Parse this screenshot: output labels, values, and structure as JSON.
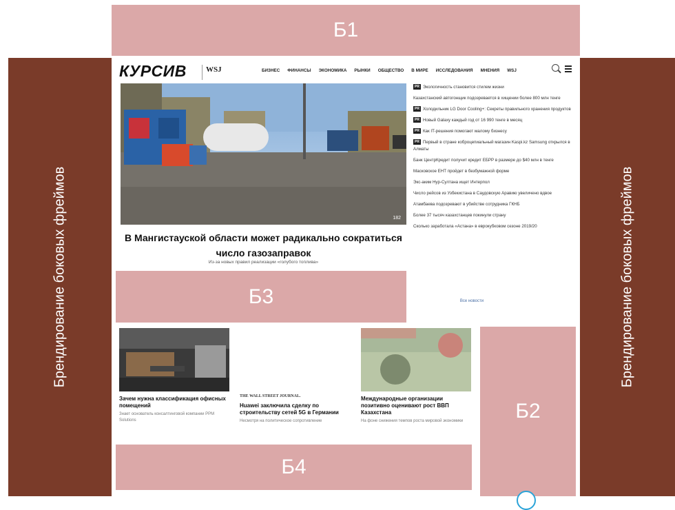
{
  "banners": {
    "b1": "Б1",
    "b2": "Б2",
    "b3": "Б3",
    "b4": "Б4",
    "side_left": "Брендирование боковых фреймов",
    "side_right": "Брендирование боковых фреймов"
  },
  "colors": {
    "side_frame": "#7a3b29",
    "ad_placeholder": "#dba8a8",
    "accent_link": "#4a6fa5"
  },
  "site": {
    "logo": "КУРСИВ",
    "logo_partner": "WSJ",
    "nav": [
      "БИЗНЕС",
      "ФИНАНСЫ",
      "ЭКОНОМИКА",
      "РЫНКИ",
      "ОБЩЕСТВО",
      "В МИРЕ",
      "ИССЛЕДОВАНИЯ",
      "МНЕНИЯ",
      "WSJ"
    ],
    "icons": [
      "search-icon",
      "menu-icon"
    ]
  },
  "hero": {
    "headline": "В Мангистауской области может радикально сократиться число газозаправок",
    "subline": "Из-за новых правил реализации «голубого топлива»",
    "photo_count": "182"
  },
  "news": [
    {
      "pr": true,
      "text": "Экологичность становится стилем жизни"
    },
    {
      "pr": false,
      "text": "Казахстанский автогонщик подозревается в хищении более 800 млн тенге"
    },
    {
      "pr": true,
      "text": "Холодильник LG Door Cooling+: Секреты правильного хранения продуктов"
    },
    {
      "pr": true,
      "text": "Новый Galaxy каждый год от 16 990 тенге в месяц"
    },
    {
      "pr": true,
      "text": "Как IT-решения помогают малому бизнесу"
    },
    {
      "pr": true,
      "text": "Первый в стране коброцепиальный магазин Kaspi.kz Samsung открылся в Алматы"
    },
    {
      "pr": false,
      "text": "Банк ЦентрКредит получит кредит ЕБРР в размере до $40 млн в тенге"
    },
    {
      "pr": false,
      "text": "Масковское ЕНТ пройдет в безбумажной форме"
    },
    {
      "pr": false,
      "text": "Экс-аким Нур-Султана ищет Интерпол"
    },
    {
      "pr": false,
      "text": "Число рейсов из Узбекистана в Саудовскую Аравию увеличено вдвое"
    },
    {
      "pr": false,
      "text": "Атамбаева подозревают в убийстве сотрудника ГКНБ"
    },
    {
      "pr": false,
      "text": "Более 37 тысяч казахстанцев покинули страну"
    },
    {
      "pr": false,
      "text": "Сколько заработала «Астана» в еврокубковом сезоне 2019/20"
    }
  ],
  "all_news_label": "Все новости",
  "cards": [
    {
      "title": "Зачем нужна классификация офисных помещений",
      "text": "Знает основатель консалтинговой компании PPM Solutions"
    },
    {
      "source": "THE WALL STREET JOURNAL.",
      "title": "Huawei заключила сделку по строительству сетей 5G в Германии",
      "text": "Несмотря на политическое сопротивление"
    },
    {
      "title": "Международные организации позитивно оценивают рост ВВП Казахстана",
      "text": "На фоне снижения темпов роста мировой экономики"
    }
  ]
}
